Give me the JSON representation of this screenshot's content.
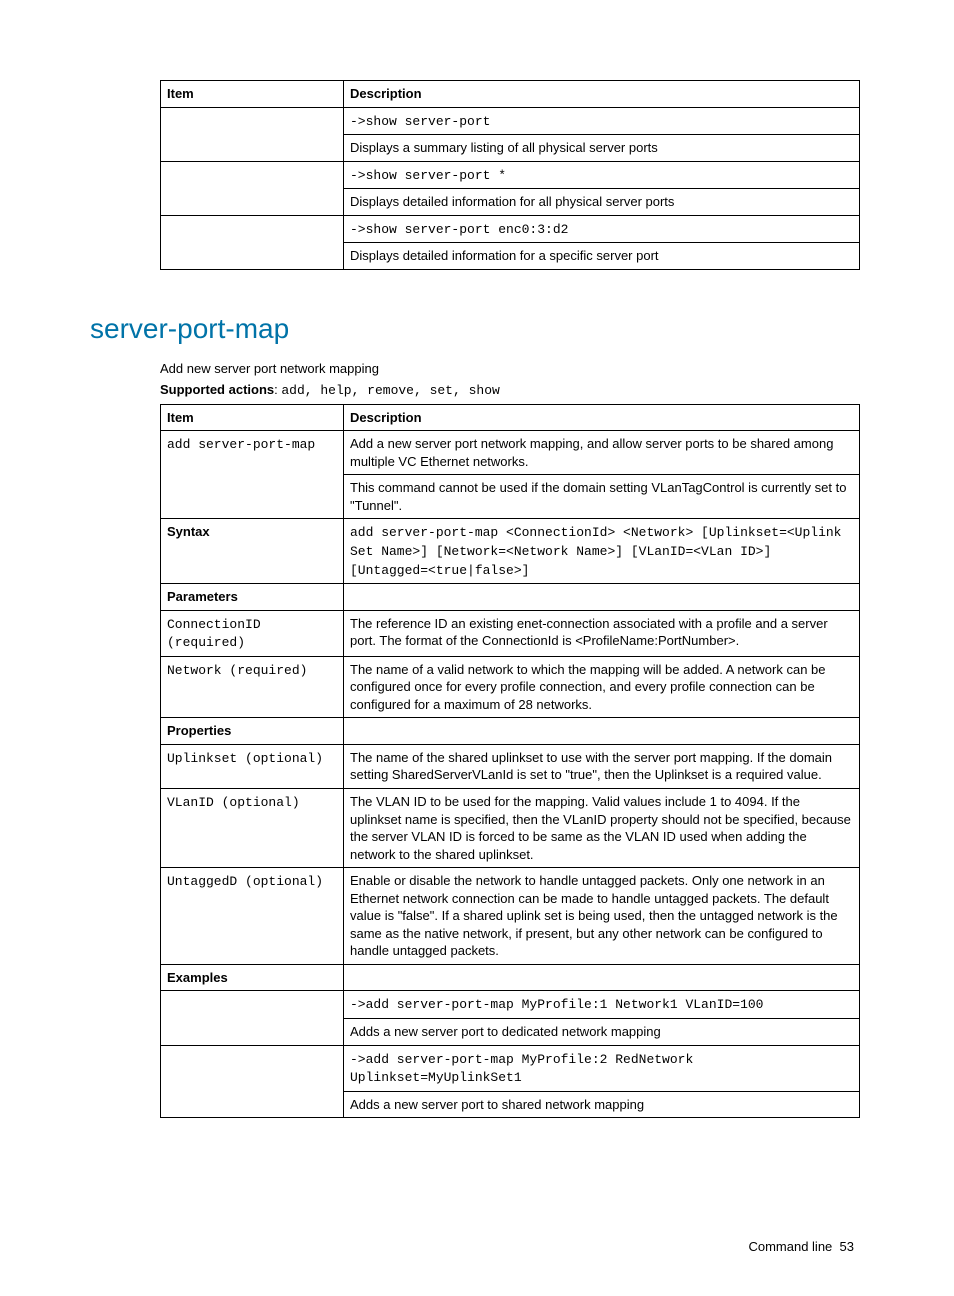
{
  "table1": {
    "header": {
      "item": "Item",
      "desc": "Description"
    },
    "rows": [
      {
        "code": "->show server-port",
        "desc": "Displays a summary listing of all physical server ports"
      },
      {
        "code": "->show server-port *",
        "desc": "Displays detailed information for all physical server ports"
      },
      {
        "code": "->show server-port enc0:3:d2",
        "desc": "Displays detailed information for a specific server port"
      }
    ]
  },
  "section": {
    "title": "server-port-map",
    "intro": "Add new server port network mapping",
    "supported_label": "Supported actions",
    "supported_actions": "add, help, remove, set, show"
  },
  "table2": {
    "header": {
      "item": "Item",
      "desc": "Description"
    },
    "rows": {
      "add_cmd": "add server-port-map",
      "add_desc1": "Add a new server port network mapping, and allow server ports to be shared among multiple VC Ethernet networks.",
      "add_desc2": "This command cannot be used if the domain setting VLanTagControl is currently set to \"Tunnel\".",
      "syntax_label": "Syntax",
      "syntax_code": "add server-port-map <ConnectionId> <Network> [Uplinkset=<Uplink Set Name>] [Network=<Network Name>] [VLanID=<VLan ID>] [Untagged=<true|false>]",
      "params_label": "Parameters",
      "connid_item": "ConnectionID (required)",
      "connid_desc": "The reference ID an existing enet-connection associated with a profile and a server port. The format of the ConnectionId is <ProfileName:PortNumber>.",
      "network_item": "Network (required)",
      "network_desc": "The name of a valid network to which the mapping will be added. A network can be configured once for every profile connection, and every profile connection can be configured for a maximum of 28 networks.",
      "props_label": "Properties",
      "uplink_item": "Uplinkset (optional)",
      "uplink_desc": "The name of the shared uplinkset to use with the server port mapping. If the domain setting SharedServerVLanId is set to \"true\", then the Uplinkset is a required value.",
      "vlan_item": "VLanID (optional)",
      "vlan_desc": "The VLAN ID to be used for the mapping. Valid values include 1 to 4094. If the uplinkset name is specified, then the VLanID property should not be specified, because the server VLAN ID is forced to be same as the VLAN ID used when adding the network to the shared uplinkset.",
      "untag_item": "UntaggedD (optional)",
      "untag_desc": "Enable or disable the network to handle untagged packets. Only one network in an Ethernet network connection can be made to handle untagged packets. The default value is \"false\". If a shared uplink set is being used, then the untagged network is the same as the native network, if present, but any other network can be configured to handle untagged packets.",
      "examples_label": "Examples",
      "ex1_code": "->add server-port-map MyProfile:1 Network1 VLanID=100",
      "ex1_desc": "Adds a new server port to dedicated network mapping",
      "ex2_code": "->add server-port-map MyProfile:2 RedNetwork Uplinkset=MyUplinkSet1",
      "ex2_desc": "Adds a new server port to shared network mapping"
    }
  },
  "footer": {
    "label": "Command line",
    "page": "53"
  }
}
